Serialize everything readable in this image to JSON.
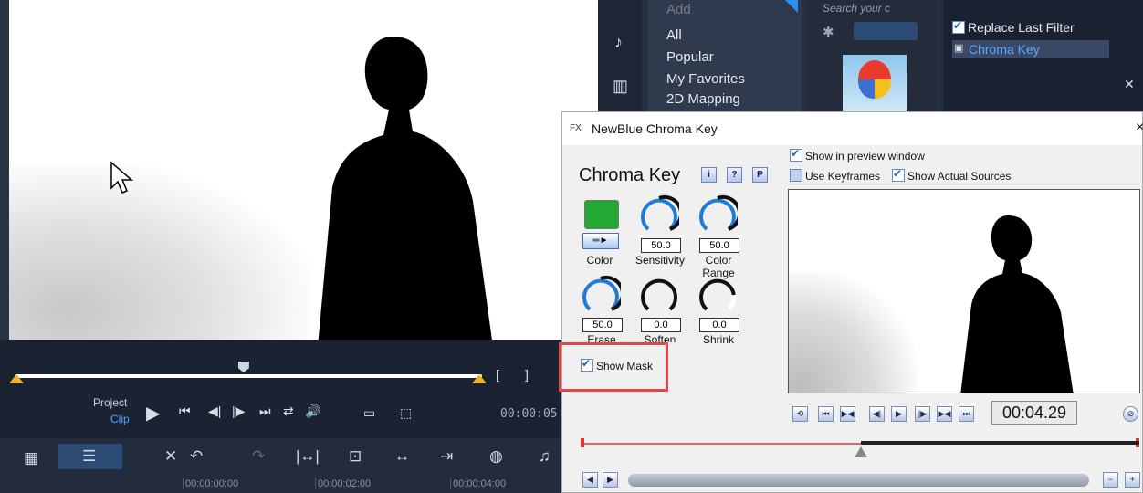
{
  "library": {
    "search_placeholder": "Search your c",
    "add_label": "Add",
    "categories": [
      "All",
      "Popular",
      "My Favorites",
      "2D Mapping"
    ],
    "replace_last_filter": "Replace Last Filter",
    "applied_filter": "Chroma Key"
  },
  "transport": {
    "project_label": "Project",
    "clip_label": "Clip",
    "timecode": "00:00:05",
    "scrub_position": 0.49
  },
  "timeline": {
    "ruler": [
      "00:00:00:00",
      "00:00:02:00",
      "00:00:04:00"
    ]
  },
  "dialog": {
    "title": "NewBlue Chroma Key",
    "heading": "Chroma Key",
    "help_buttons": [
      "i",
      "?",
      "P"
    ],
    "show_in_preview": "Show in preview window",
    "use_keyframes": "Use Keyframes",
    "show_actual_sources": "Show Actual Sources",
    "color_label": "Color",
    "sensitivity_value": "50.0",
    "sensitivity_label": "Sensitivity",
    "color_range_value": "50.0",
    "color_range_label": "Color Range",
    "erase_value": "50.0",
    "erase_label": "Erase",
    "soften_value": "0.0",
    "soften_label": "Soften",
    "shrink_value": "0.0",
    "shrink_label": "Shrink",
    "show_mask": "Show Mask",
    "timecode": "00:04.29",
    "key_color": "#22a833"
  }
}
